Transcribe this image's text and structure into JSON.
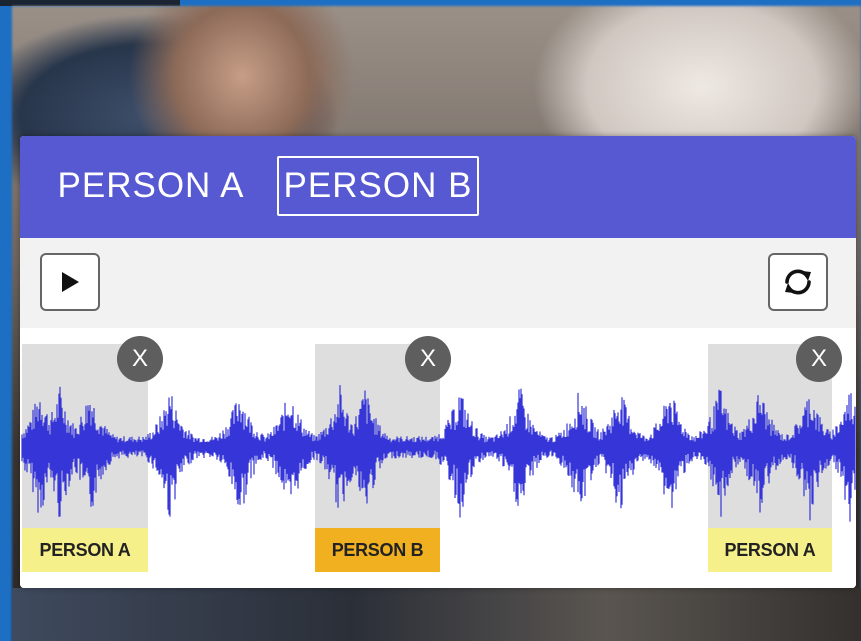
{
  "tabs": [
    {
      "label": "PERSON A",
      "selected": false
    },
    {
      "label": "PERSON B",
      "selected": true
    }
  ],
  "toolbar": {
    "play_icon": "play-icon",
    "refresh_icon": "refresh-icon"
  },
  "segments": [
    {
      "label": "PERSON A",
      "close": "X",
      "label_color": "#f6f08a"
    },
    {
      "label": "PERSON B",
      "close": "X",
      "label_color": "#f0b020"
    },
    {
      "label": "PERSON A",
      "close": "X",
      "label_color": "#f6f08a"
    }
  ],
  "colors": {
    "tab_bar": "#5659d2",
    "waveform": "#3636d8",
    "segment_bg": "#dedede"
  }
}
